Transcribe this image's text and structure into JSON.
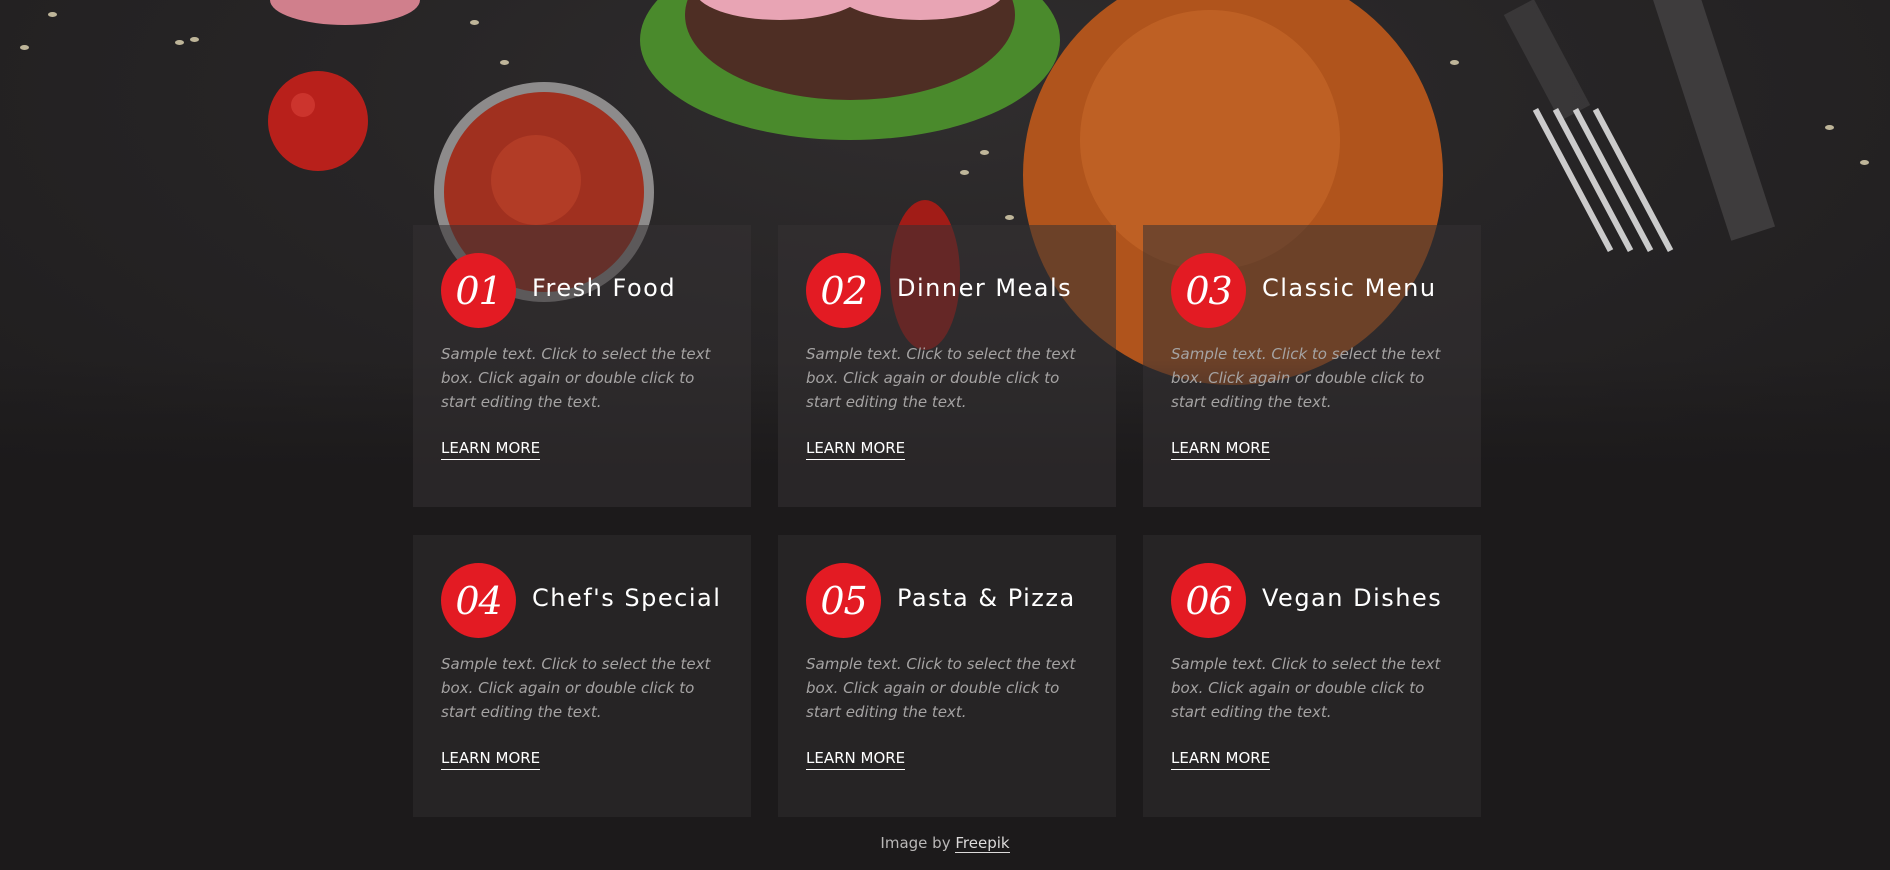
{
  "cards": [
    {
      "number": "01",
      "title": "Fresh Food",
      "text": "Sample text. Click to select the text box. Click again or double click to start editing the text.",
      "link": "LEARN MORE"
    },
    {
      "number": "02",
      "title": "Dinner Meals",
      "text": "Sample text. Click to select the text box. Click again or double click to start editing the text.",
      "link": "LEARN MORE"
    },
    {
      "number": "03",
      "title": "Classic Menu",
      "text": "Sample text. Click to select the text box. Click again or double click to start editing the text.",
      "link": "LEARN MORE"
    },
    {
      "number": "04",
      "title": "Chef's Special",
      "text": "Sample text. Click to select the text box. Click again or double click to start editing the text.",
      "link": "LEARN MORE"
    },
    {
      "number": "05",
      "title": "Pasta & Pizza",
      "text": "Sample text. Click to select the text box. Click again or double click to start editing the text.",
      "link": "LEARN MORE"
    },
    {
      "number": "06",
      "title": "Vegan Dishes",
      "text": "Sample text. Click to select the text box. Click again or double click to start editing the text.",
      "link": "LEARN MORE"
    }
  ],
  "footer": {
    "prefix": "Image by",
    "link": "Freepik"
  },
  "colors": {
    "accent": "#e31b23",
    "background": "#1c1a1b"
  }
}
